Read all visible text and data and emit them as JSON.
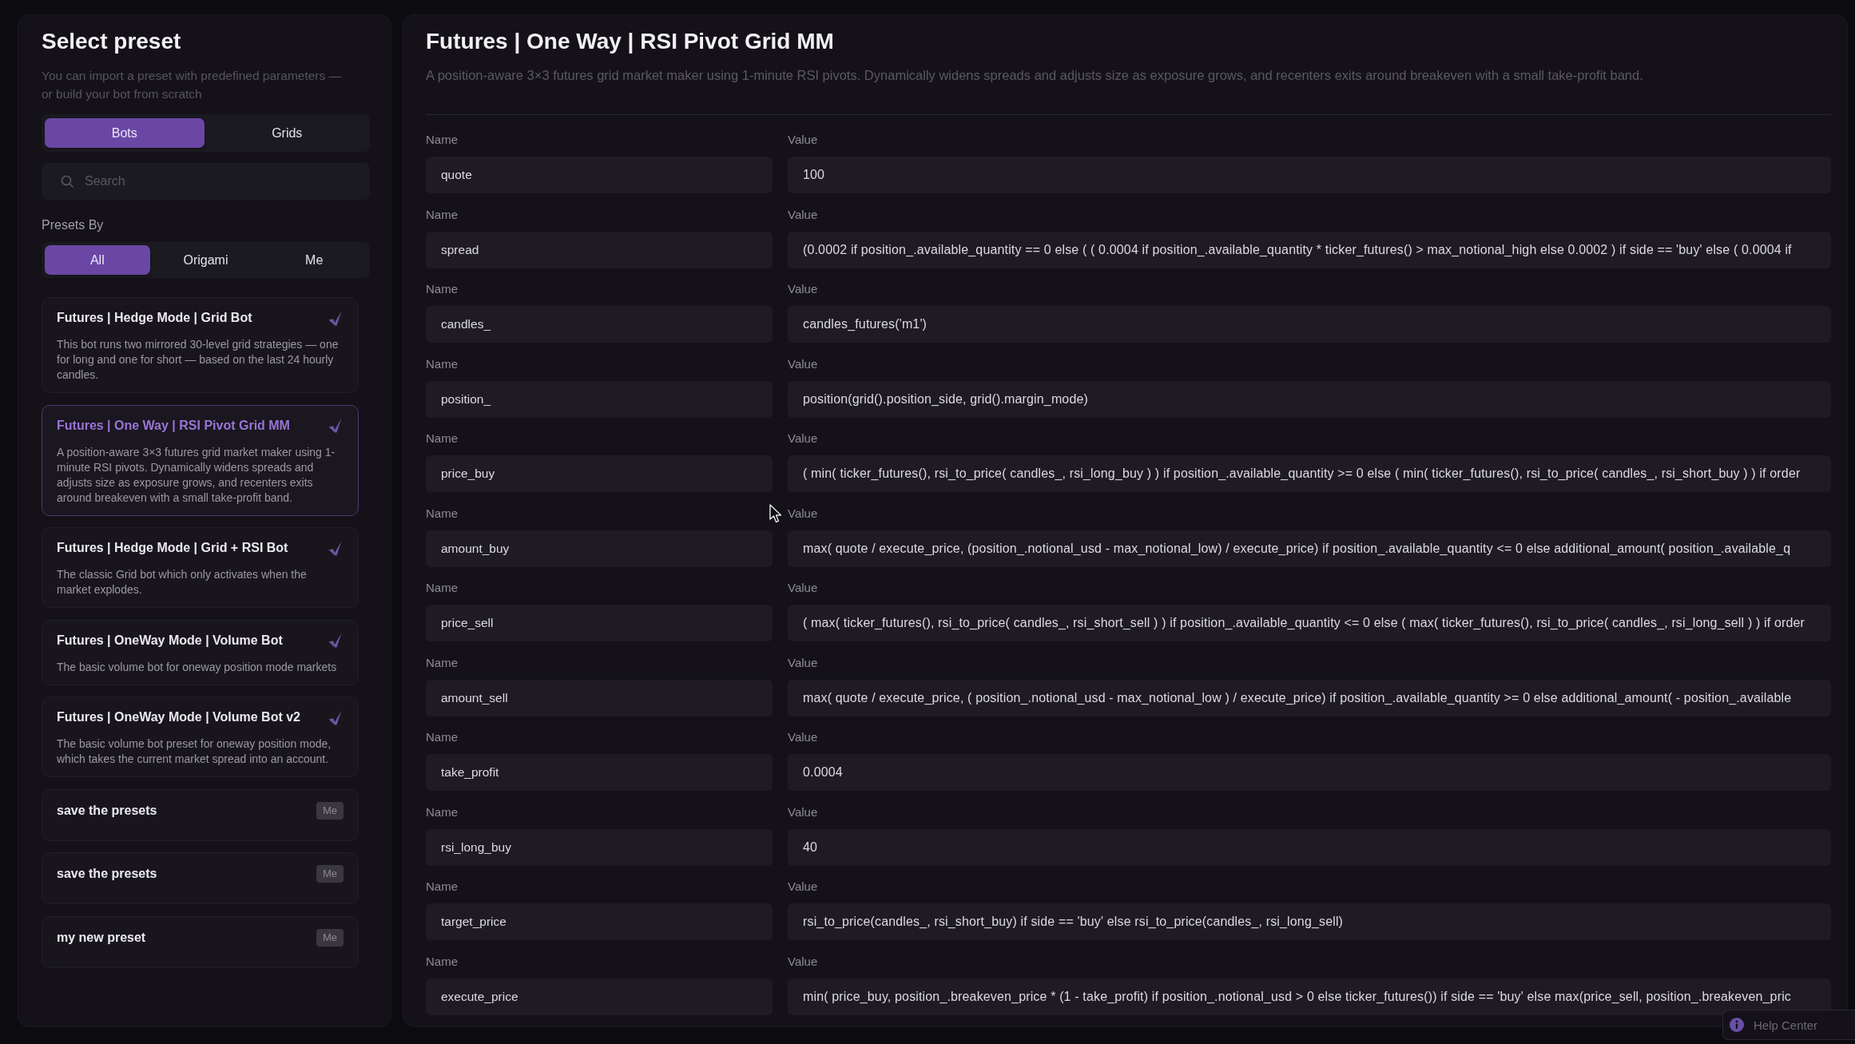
{
  "sidebar": {
    "title": "Select preset",
    "subtitle": "You can import a preset with predefined parameters — or build your bot from scratch",
    "type_tabs": [
      {
        "label": "Bots",
        "selected": true
      },
      {
        "label": "Grids",
        "selected": false
      }
    ],
    "search": {
      "placeholder": "Search"
    },
    "filter_label": "Presets By",
    "filter_tabs": [
      {
        "label": "All",
        "selected": true
      },
      {
        "label": "Origami",
        "selected": false
      },
      {
        "label": "Me",
        "selected": false
      }
    ],
    "presets": [
      {
        "kind": "verified",
        "title": "Futures | Hedge Mode | Grid Bot",
        "description": "This bot runs two mirrored 30-level grid strategies — one for long and one for short — based on the last 24 hourly candles.",
        "selected": false
      },
      {
        "kind": "verified",
        "title": "Futures | One Way | RSI Pivot Grid MM",
        "description": "A position-aware 3×3 futures grid market maker using 1-minute RSI pivots. Dynamically widens spreads and adjusts size as exposure grows, and recenters exits around breakeven with a small take-profit band.",
        "selected": true
      },
      {
        "kind": "verified",
        "title": "Futures | Hedge Mode | Grid + RSI Bot",
        "description": "The classic Grid bot which only activates when the market explodes.",
        "selected": false
      },
      {
        "kind": "verified",
        "title": "Futures | OneWay Mode | Volume Bot",
        "description": "The basic volume bot for oneway position mode markets",
        "selected": false
      },
      {
        "kind": "verified",
        "title": "Futures | OneWay Mode | Volume Bot v2",
        "description": "The basic volume bot preset for oneway position mode, which takes the current market spread into an account.",
        "selected": false
      },
      {
        "kind": "own",
        "title": "save the presets",
        "badge": "Me",
        "selected": false
      },
      {
        "kind": "own",
        "title": "save the presets",
        "badge": "Me",
        "selected": false
      },
      {
        "kind": "own",
        "title": "my new preset",
        "badge": "Me",
        "selected": false
      }
    ]
  },
  "detail": {
    "title": "Futures | One Way | RSI Pivot Grid MM",
    "description": "A position-aware 3×3 futures grid market maker using 1-minute RSI pivots. Dynamically widens spreads and adjusts size as exposure grows, and recenters exits around breakeven with a small take-profit band.",
    "parameters": [
      {
        "name_label": "Name",
        "name": "quote",
        "value_label": "Value",
        "value": "100"
      },
      {
        "name_label": "Name",
        "name": "spread",
        "value_label": "Value",
        "value": "(0.0002 if position_.available_quantity == 0 else ( ( 0.0004 if position_.available_quantity * ticker_futures() > max_notional_high else 0.0002 ) if side == 'buy' else ( 0.0004 if"
      },
      {
        "name_label": "Name",
        "name": "candles_",
        "value_label": "Value",
        "value": "candles_futures('m1')"
      },
      {
        "name_label": "Name",
        "name": "position_",
        "value_label": "Value",
        "value": "position(grid().position_side, grid().margin_mode)"
      },
      {
        "name_label": "Name",
        "name": "price_buy",
        "value_label": "Value",
        "value": "( min( ticker_futures(), rsi_to_price( candles_, rsi_long_buy ) ) if position_.available_quantity >= 0 else ( min( ticker_futures(), rsi_to_price( candles_, rsi_short_buy ) ) if order"
      },
      {
        "name_label": "Name",
        "name": "amount_buy",
        "value_label": "Value",
        "value": "max( quote / execute_price, (position_.notional_usd - max_notional_low) / execute_price) if position_.available_quantity <= 0 else additional_amount( position_.available_q"
      },
      {
        "name_label": "Name",
        "name": "price_sell",
        "value_label": "Value",
        "value": "( max( ticker_futures(), rsi_to_price( candles_, rsi_short_sell ) ) if position_.available_quantity <= 0 else ( max( ticker_futures(), rsi_to_price( candles_, rsi_long_sell ) ) if order"
      },
      {
        "name_label": "Name",
        "name": "amount_sell",
        "value_label": "Value",
        "value": "max( quote / execute_price, ( position_.notional_usd - max_notional_low ) / execute_price) if position_.available_quantity >= 0 else additional_amount( - position_.available"
      },
      {
        "name_label": "Name",
        "name": "take_profit",
        "value_label": "Value",
        "value": "0.0004"
      },
      {
        "name_label": "Name",
        "name": "rsi_long_buy",
        "value_label": "Value",
        "value": "40"
      },
      {
        "name_label": "Name",
        "name": "target_price",
        "value_label": "Value",
        "value": "rsi_to_price(candles_, rsi_short_buy) if side == 'buy' else rsi_to_price(candles_, rsi_long_sell)"
      },
      {
        "name_label": "Name",
        "name": "execute_price",
        "value_label": "Value",
        "value": "min( price_buy, position_.breakeven_price * (1 - take_profit) if position_.notional_usd > 0 else ticker_futures()) if side == 'buy' else max(price_sell, position_.breakeven_pric"
      }
    ]
  },
  "help_button": {
    "label": "Help Center"
  }
}
